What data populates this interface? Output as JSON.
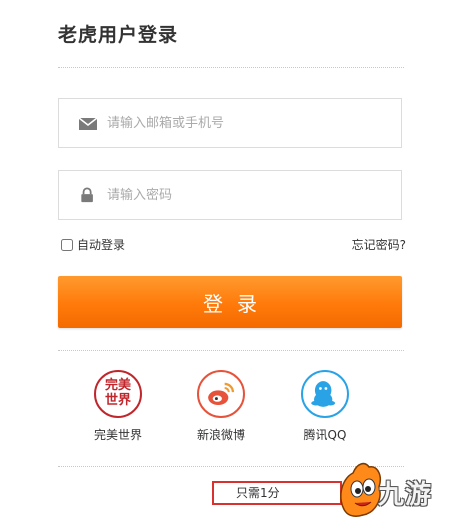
{
  "page": {
    "title": "老虎用户登录"
  },
  "form": {
    "email_placeholder": "请输入邮箱或手机号",
    "password_placeholder": "请输入密码",
    "remember_label": "自动登录",
    "forgot_label": "忘记密码?",
    "login_label": "登录"
  },
  "social": [
    {
      "label": "完美世界",
      "icon": "perfect-world-logo",
      "logo_line1": "完美",
      "logo_line2": "世界",
      "color": "#c0272d"
    },
    {
      "label": "新浪微博",
      "icon": "weibo-icon",
      "color": "#e6533a"
    },
    {
      "label": "腾讯QQ",
      "icon": "qq-icon",
      "color": "#2aa3e6"
    }
  ],
  "footer": {
    "text": "只需1分"
  },
  "watermark": {
    "text": "九游"
  },
  "colors": {
    "accent": "#ff7f0e",
    "footer_border": "#d93030"
  }
}
